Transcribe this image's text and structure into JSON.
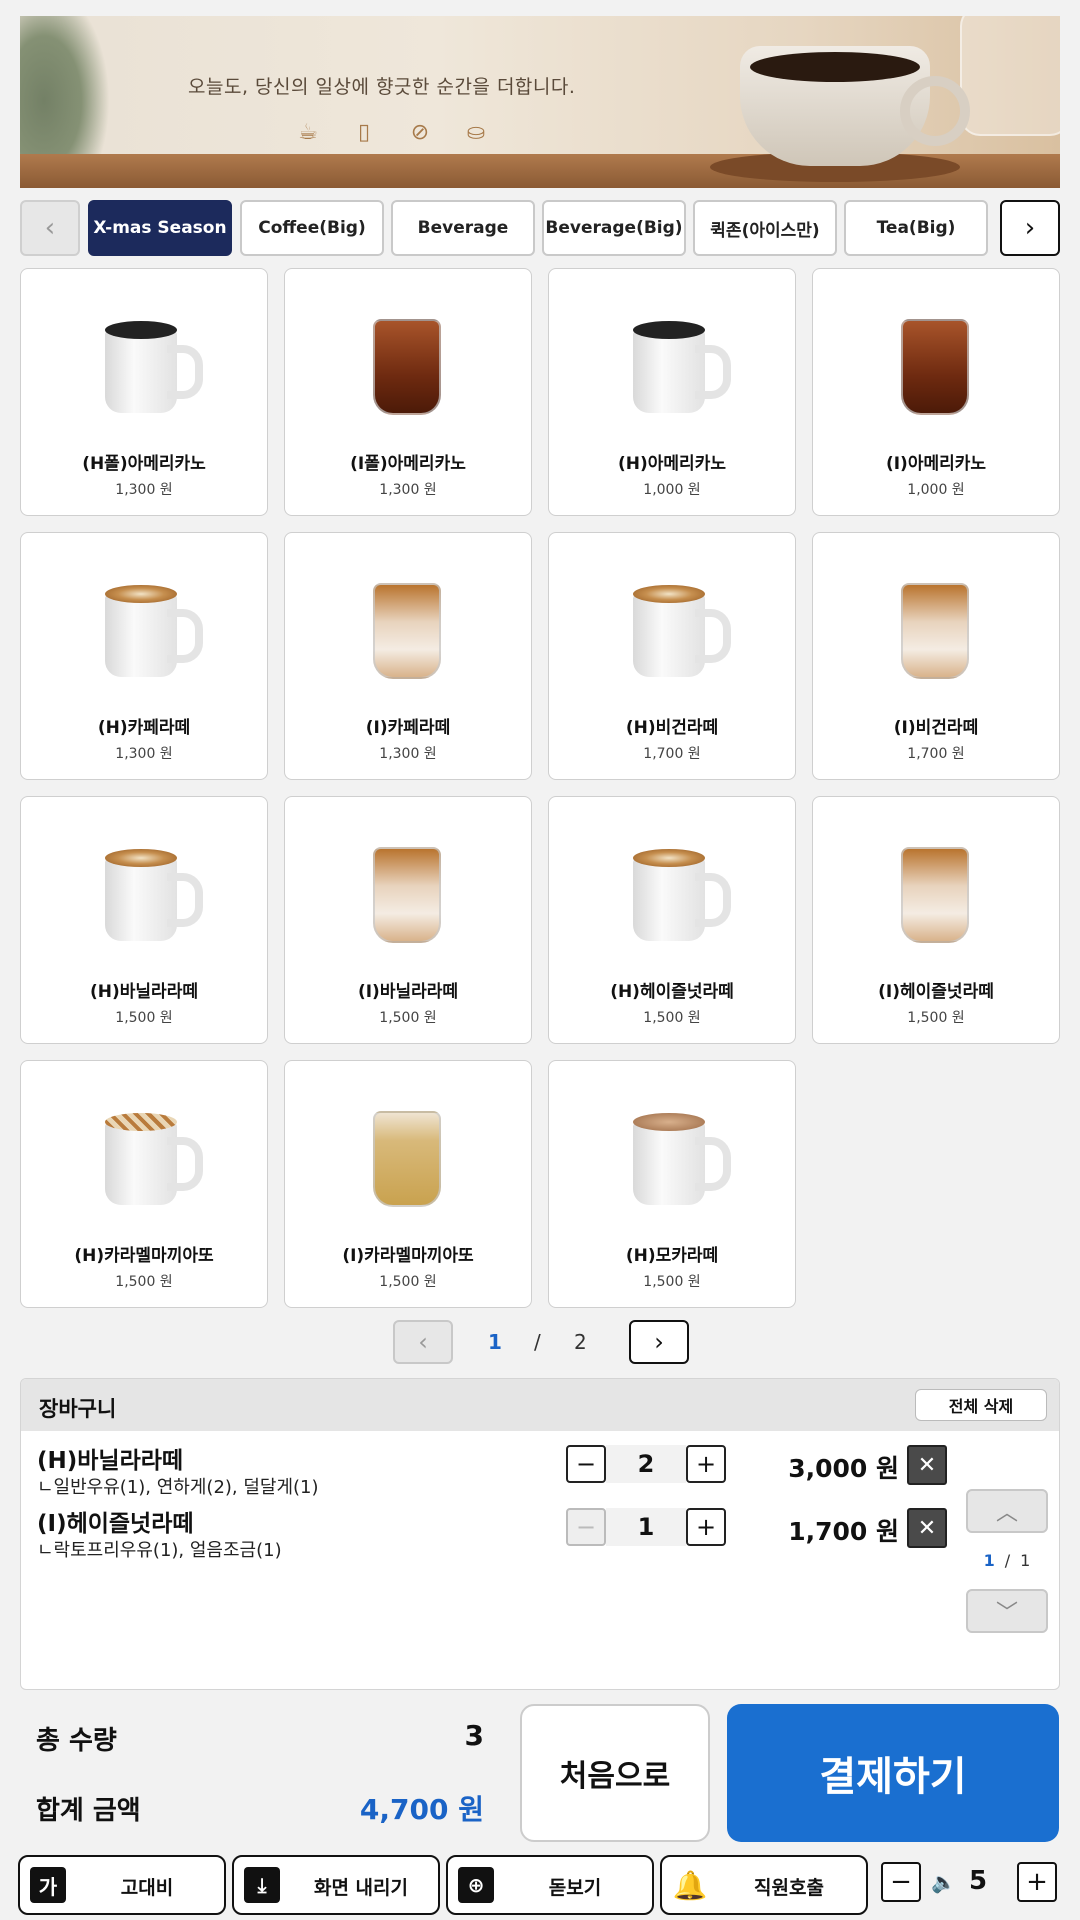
{
  "banner": {
    "message": "오늘도, 당신의 일상에 향긋한 순간을 더합니다.",
    "icons": [
      "coffee-cup-icon",
      "takeout-cup-icon",
      "coffee-bean-icon",
      "cake-icon"
    ]
  },
  "categories": {
    "items": [
      "X-mas Season",
      "Coffee(Big)",
      "Beverage",
      "Beverage(Big)",
      "퀵존(아이스만)",
      "Tea(Big)"
    ],
    "active": "X-mas Season",
    "accent_color": "#1c2a5c"
  },
  "menu": {
    "items": [
      {
        "name": "(H폴)아메리카노",
        "price": "1,300 원",
        "icon": "hot-americano"
      },
      {
        "name": "(I폴)아메리카노",
        "price": "1,300 원",
        "icon": "iced-americano"
      },
      {
        "name": "(H)아메리카노",
        "price": "1,000 원",
        "icon": "hot-americano"
      },
      {
        "name": "(I)아메리카노",
        "price": "1,000 원",
        "icon": "iced-americano"
      },
      {
        "name": "(H)카페라떼",
        "price": "1,300 원",
        "icon": "hot-latte"
      },
      {
        "name": "(I)카페라떼",
        "price": "1,300 원",
        "icon": "iced-latte"
      },
      {
        "name": "(H)비건라떼",
        "price": "1,700 원",
        "icon": "hot-latte"
      },
      {
        "name": "(I)비건라떼",
        "price": "1,700 원",
        "icon": "iced-latte"
      },
      {
        "name": "(H)바닐라라떼",
        "price": "1,500 원",
        "icon": "hot-latte"
      },
      {
        "name": "(I)바닐라라떼",
        "price": "1,500 원",
        "icon": "iced-latte"
      },
      {
        "name": "(H)헤이즐넛라떼",
        "price": "1,500 원",
        "icon": "hot-latte"
      },
      {
        "name": "(I)헤이즐넛라떼",
        "price": "1,500 원",
        "icon": "iced-latte"
      },
      {
        "name": "(H)카라멜마끼아또",
        "price": "1,500 원",
        "icon": "hot-caramel"
      },
      {
        "name": "(I)카라멜마끼아또",
        "price": "1,500 원",
        "icon": "iced-caramel"
      },
      {
        "name": "(H)모카라떼",
        "price": "1,500 원",
        "icon": "hot-mocha"
      }
    ]
  },
  "pagination": {
    "current": "1",
    "separator": "/",
    "total": "2"
  },
  "cart": {
    "title": "장바구니",
    "clear_all": "전체 삭제",
    "items": [
      {
        "name": "(H)바닐라라떼",
        "options": "ㄴ일반우유(1), 연하게(2), 덜달게(1)",
        "qty": "2",
        "price": "3,000 원",
        "minus_disabled": false
      },
      {
        "name": "(I)헤이즐넛라떼",
        "options": "ㄴ락토프리우유(1), 얼음조금(1)",
        "qty": "1",
        "price": "1,700 원",
        "minus_disabled": true
      }
    ],
    "page_current": "1",
    "page_separator": "/",
    "page_total": "1"
  },
  "summary": {
    "count_label": "총 수량",
    "count_value": "3",
    "total_label": "합계 금액",
    "total_value": "4,700 원"
  },
  "actions": {
    "home": "처음으로",
    "pay": "결제하기",
    "pay_color": "#1a6fd0"
  },
  "accessibility": {
    "high_contrast": "고대비",
    "lower_screen": "화면 내리기",
    "magnifier": "돋보기",
    "call_staff": "직원호출",
    "volume": "5"
  }
}
